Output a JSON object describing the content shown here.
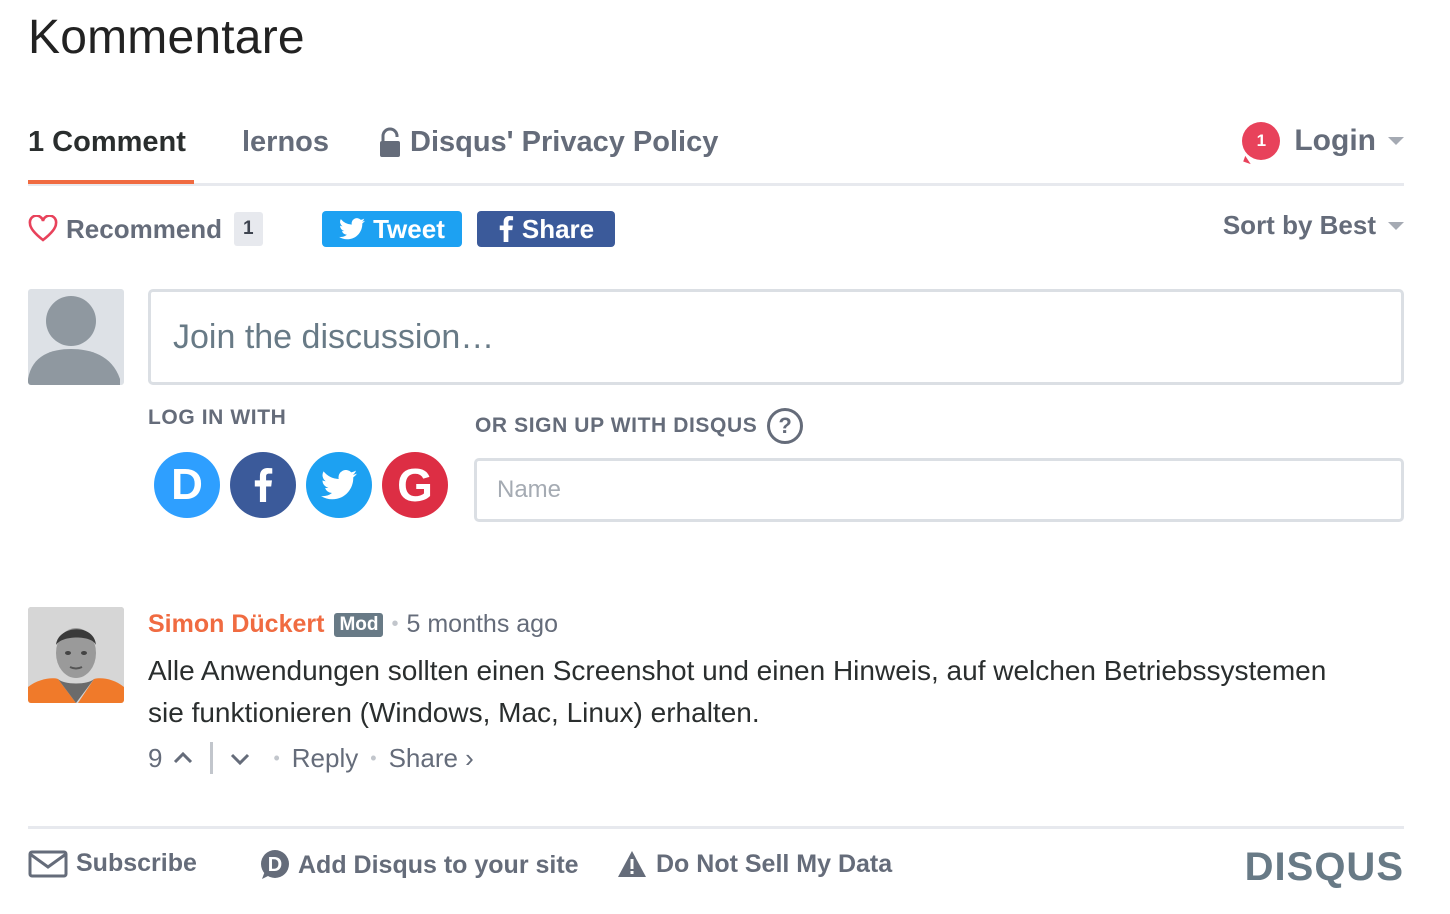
{
  "page": {
    "title": "Kommentare"
  },
  "nav": {
    "comments_tab": "1 Comment",
    "community_tab": "lernos",
    "privacy_tab": "Disqus' Privacy Policy",
    "notification_count": "1",
    "login_label": "Login"
  },
  "actions": {
    "recommend_label": "Recommend",
    "recommend_count": "1",
    "tweet_label": "Tweet",
    "share_label": "Share",
    "sort_label": "Sort by Best"
  },
  "compose": {
    "placeholder": "Join the discussion…",
    "login_with_label": "LOG IN WITH",
    "signup_label": "OR SIGN UP WITH DISQUS",
    "help_label": "?",
    "name_placeholder": "Name",
    "social": [
      {
        "name": "Disqus",
        "icon": "disqus-icon",
        "color": "#2e9fff"
      },
      {
        "name": "Facebook",
        "icon": "facebook-icon",
        "color": "#3b5a9a"
      },
      {
        "name": "Twitter",
        "icon": "twitter-icon",
        "color": "#1da1f2"
      },
      {
        "name": "Google",
        "icon": "google-icon",
        "color": "#dd2e44"
      }
    ]
  },
  "comments": [
    {
      "author": "Simon Dückert",
      "badge": "Mod",
      "time": "5 months ago",
      "text": "Alle Anwendungen sollten einen Screenshot und einen Hinweis, auf welchen Betriebssystemen sie funktionieren (Windows, Mac, Linux) erhalten.",
      "votes": "9",
      "reply_label": "Reply",
      "share_label": "Share ›"
    }
  ],
  "footer": {
    "subscribe_label": "Subscribe",
    "add_disqus_label": "Add Disqus to your site",
    "do_not_sell_label": "Do Not Sell My Data",
    "brand": "DISQUS"
  },
  "colors": {
    "accent": "#f06b41",
    "text_muted": "#656c7a",
    "badge_red": "#e8425b"
  }
}
